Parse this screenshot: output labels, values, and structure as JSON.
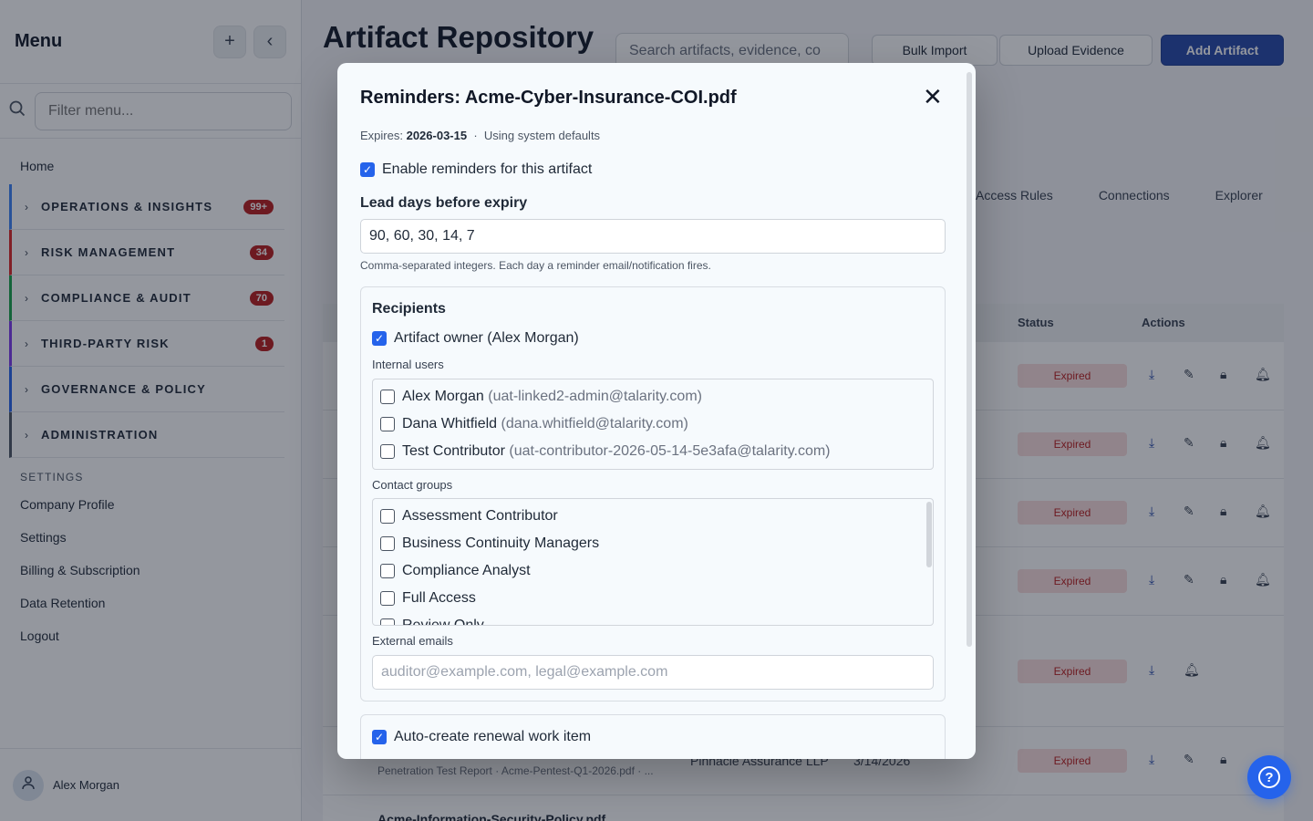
{
  "sidebar": {
    "title": "Menu",
    "add_icon": "plus-icon",
    "collapse_icon": "chevron-left-icon",
    "filter_placeholder": "Filter menu...",
    "home": "Home",
    "sections": [
      {
        "label": "OPERATIONS & INSIGHTS",
        "badge": "99+",
        "color": "#3b82f6"
      },
      {
        "label": "RISK MANAGEMENT",
        "badge": "34",
        "color": "#dc2626"
      },
      {
        "label": "COMPLIANCE & AUDIT",
        "badge": "70",
        "color": "#16a34a"
      },
      {
        "label": "THIRD-PARTY RISK",
        "badge": "1",
        "color": "#7c3aed"
      },
      {
        "label": "GOVERNANCE & POLICY",
        "badge": "",
        "color": "#2563eb"
      },
      {
        "label": "ADMINISTRATION",
        "badge": "",
        "color": "#4b5563"
      }
    ],
    "settings_label": "SETTINGS",
    "links": [
      "Company Profile",
      "Settings",
      "Billing & Subscription",
      "Data Retention",
      "Logout"
    ],
    "user_name": "Alex Morgan"
  },
  "main": {
    "page_title": "Artifact Repository",
    "search_placeholder": "Search artifacts, evidence, co",
    "buttons": {
      "bulk_import": "Bulk Import",
      "upload_evidence": "Upload Evidence",
      "add_artifact": "Add Artifact"
    },
    "tabs": [
      "Access Rules",
      "Connections",
      "Explorer"
    ],
    "columns": {
      "status": "Status",
      "actions": "Actions"
    },
    "status_value": "Expired",
    "partial_row": {
      "sub": "Penetration Test Report · Acme-Pentest-Q1-2026.pdf · ...",
      "vendor": "Pinnacle Assurance LLP",
      "date": "3/14/2026"
    },
    "next_row_title": "Acme-Information-Security-Policy.pdf"
  },
  "modal": {
    "title": "Reminders: Acme-Cyber-Insurance-COI.pdf",
    "expires_label": "Expires:",
    "expires_value": "2026-03-15",
    "defaults_text": "Using system defaults",
    "enable_label": "Enable reminders for this artifact",
    "lead_days_label": "Lead days before expiry",
    "lead_days_value": "90, 60, 30, 14, 7",
    "lead_days_help": "Comma-separated integers. Each day a reminder email/notification fires.",
    "recipients_title": "Recipients",
    "owner_label": "Artifact owner (Alex Morgan)",
    "internal_users_label": "Internal users",
    "internal_users": [
      {
        "name": "Alex Morgan",
        "email": "(uat-linked2-admin@talarity.com)"
      },
      {
        "name": "Dana Whitfield",
        "email": "(dana.whitfield@talarity.com)"
      },
      {
        "name": "Test Contributor",
        "email": "(uat-contributor-2026-05-14-5e3afa@talarity.com)"
      }
    ],
    "contact_groups_label": "Contact groups",
    "contact_groups": [
      "Assessment Contributor",
      "Business Continuity Managers",
      "Compliance Analyst",
      "Full Access",
      "Review Only"
    ],
    "external_emails_label": "External emails",
    "external_emails_placeholder": "auditor@example.com, legal@example.com",
    "auto_create_label": "Auto-create renewal work item"
  }
}
